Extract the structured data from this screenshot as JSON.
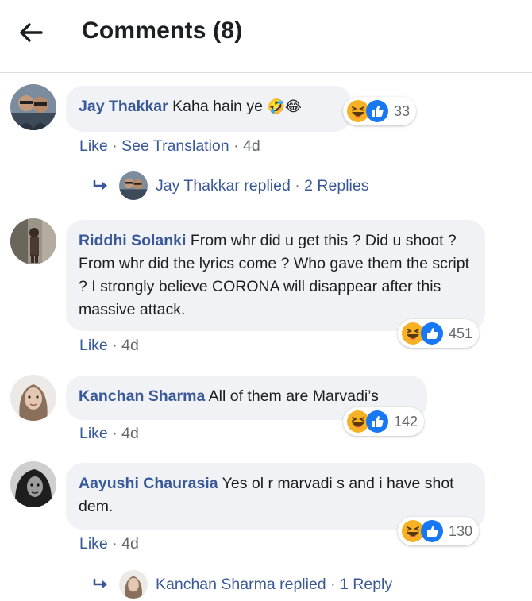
{
  "header": {
    "title": "Comments (8)"
  },
  "comments": [
    {
      "author": "Jay Thakkar",
      "text": "Kaha hain ye",
      "emoji_in_text": "🤣😂",
      "reaction_count": "33",
      "actions": {
        "like": "Like",
        "translate": "See Translation",
        "time": "4d"
      },
      "replies": {
        "name": "Jay Thakkar",
        "replied": "replied",
        "count": "2 Replies"
      }
    },
    {
      "author": "Riddhi Solanki",
      "text": "From whr did u get this ? Did u shoot ? From whr did the lyrics come ? Who gave them the script ? I strongly believe CORONA will disappear after this massive attack.",
      "reaction_count": "451",
      "actions": {
        "like": "Like",
        "time": "4d"
      }
    },
    {
      "author": "Kanchan Sharma",
      "text": "All of them are Marvadi’s",
      "reaction_count": "142",
      "actions": {
        "like": "Like",
        "time": "4d"
      }
    },
    {
      "author": "Aayushi Chaurasia",
      "text": "Yes ol r marvadi s and i have shot dem.",
      "reaction_count": "130",
      "actions": {
        "like": "Like",
        "time": "4d"
      },
      "replies": {
        "name": "Kanchan Sharma",
        "replied": "replied",
        "count": "1 Reply"
      }
    }
  ],
  "separator": "·",
  "icons": {
    "back": "arrow-left-icon",
    "haha": "haha-reaction-icon",
    "like": "like-reaction-icon",
    "reply": "reply-arrow-icon"
  },
  "colors": {
    "link": "#385898",
    "muted": "#65676b",
    "bubble": "#f0f2f5",
    "like_blue": "#1877f2",
    "haha_yellow": "#f7b125"
  }
}
